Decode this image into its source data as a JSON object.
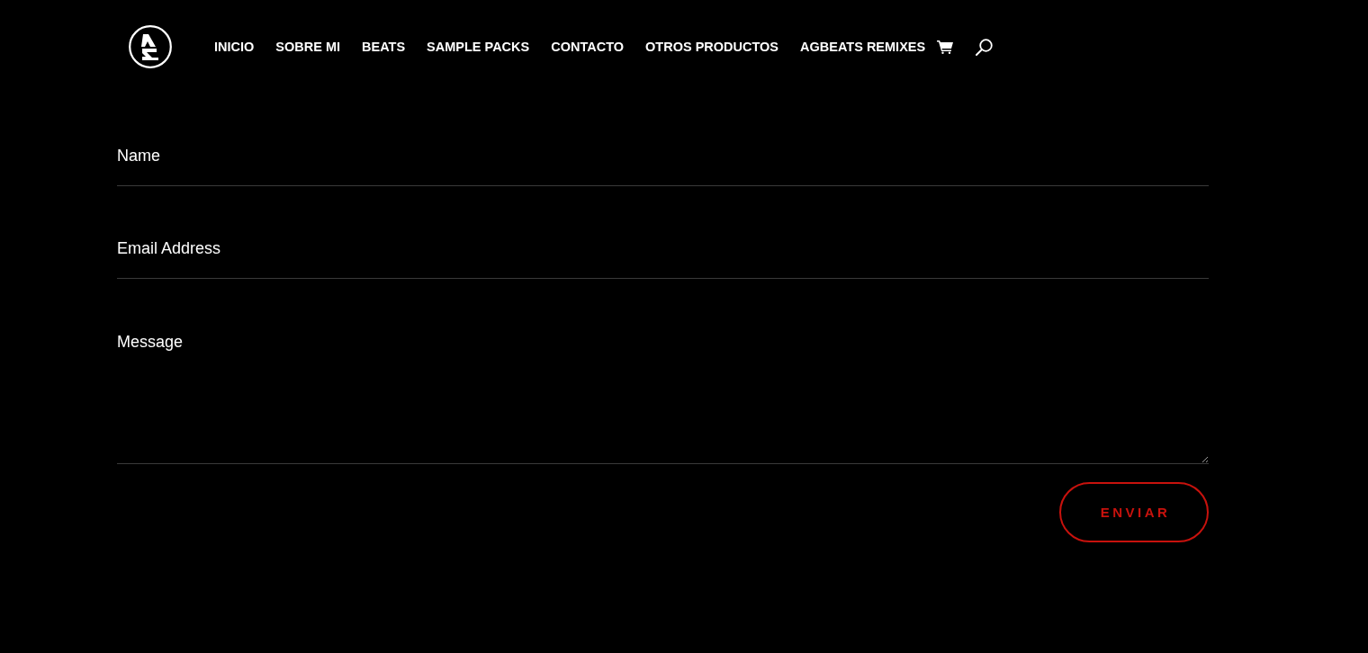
{
  "header": {
    "nav": [
      "INICIO",
      "SOBRE MI",
      "BEATS",
      "SAMPLE PACKS",
      "CONTACTO",
      "OTROS PRODUCTOS",
      "AGBEATS REMIXES"
    ]
  },
  "form": {
    "fields": [
      {
        "kind": "input",
        "placeholder": "Name"
      },
      {
        "kind": "input",
        "placeholder": "Email Address"
      },
      {
        "kind": "textarea",
        "placeholder": "Message"
      }
    ],
    "submit": "ENVIAR"
  }
}
